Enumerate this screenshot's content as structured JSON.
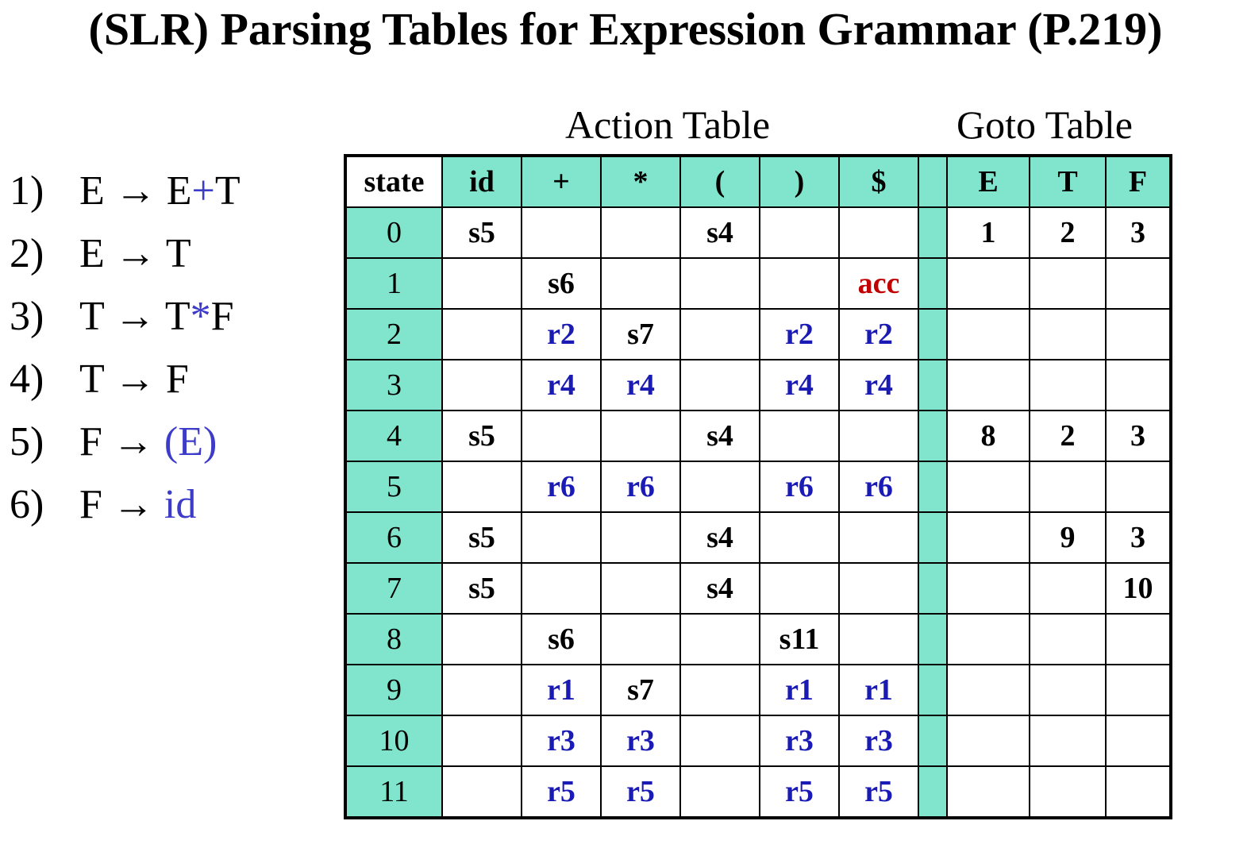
{
  "title": "(SLR) Parsing Tables for Expression Grammar (P.219)",
  "action_caption": "Action Table",
  "goto_caption": "Goto Table",
  "grammar": [
    {
      "num": "1)",
      "parts": [
        {
          "t": "E → E",
          "c": false
        },
        {
          "t": "+",
          "c": true
        },
        {
          "t": "T",
          "c": false
        }
      ]
    },
    {
      "num": "2)",
      "parts": [
        {
          "t": "E → T",
          "c": false
        }
      ]
    },
    {
      "num": "3)",
      "parts": [
        {
          "t": "T → T",
          "c": false
        },
        {
          "t": "*",
          "c": true
        },
        {
          "t": "F",
          "c": false
        }
      ]
    },
    {
      "num": "4)",
      "parts": [
        {
          "t": "T → F",
          "c": false
        }
      ]
    },
    {
      "num": "5)",
      "parts": [
        {
          "t": "F → ",
          "c": false
        },
        {
          "t": "(E)",
          "c": true
        }
      ]
    },
    {
      "num": "6)",
      "parts": [
        {
          "t": "F → ",
          "c": false
        },
        {
          "t": "id",
          "c": true
        }
      ]
    }
  ],
  "table": {
    "state_header": "state",
    "action_headers": [
      "id",
      "+",
      "*",
      "(",
      ")",
      "$"
    ],
    "goto_headers": [
      "E",
      "T",
      "F"
    ],
    "rows": [
      {
        "state": "0",
        "action": [
          "s5",
          "",
          "",
          "s4",
          "",
          ""
        ],
        "goto": [
          "1",
          "2",
          "3"
        ]
      },
      {
        "state": "1",
        "action": [
          "",
          "s6",
          "",
          "",
          "",
          "acc"
        ],
        "goto": [
          "",
          "",
          ""
        ]
      },
      {
        "state": "2",
        "action": [
          "",
          "r2",
          "s7",
          "",
          "r2",
          "r2"
        ],
        "goto": [
          "",
          "",
          ""
        ]
      },
      {
        "state": "3",
        "action": [
          "",
          "r4",
          "r4",
          "",
          "r4",
          "r4"
        ],
        "goto": [
          "",
          "",
          ""
        ]
      },
      {
        "state": "4",
        "action": [
          "s5",
          "",
          "",
          "s4",
          "",
          ""
        ],
        "goto": [
          "8",
          "2",
          "3"
        ]
      },
      {
        "state": "5",
        "action": [
          "",
          "r6",
          "r6",
          "",
          "r6",
          "r6"
        ],
        "goto": [
          "",
          "",
          ""
        ]
      },
      {
        "state": "6",
        "action": [
          "s5",
          "",
          "",
          "s4",
          "",
          ""
        ],
        "goto": [
          "",
          "9",
          "3"
        ]
      },
      {
        "state": "7",
        "action": [
          "s5",
          "",
          "",
          "s4",
          "",
          ""
        ],
        "goto": [
          "",
          "",
          "10"
        ]
      },
      {
        "state": "8",
        "action": [
          "",
          "s6",
          "",
          "",
          "s11",
          ""
        ],
        "goto": [
          "",
          "",
          ""
        ]
      },
      {
        "state": "9",
        "action": [
          "",
          "r1",
          "s7",
          "",
          "r1",
          "r1"
        ],
        "goto": [
          "",
          "",
          ""
        ]
      },
      {
        "state": "10",
        "action": [
          "",
          "r3",
          "r3",
          "",
          "r3",
          "r3"
        ],
        "goto": [
          "",
          "",
          ""
        ]
      },
      {
        "state": "11",
        "action": [
          "",
          "r5",
          "r5",
          "",
          "r5",
          "r5"
        ],
        "goto": [
          "",
          "",
          ""
        ]
      }
    ]
  }
}
